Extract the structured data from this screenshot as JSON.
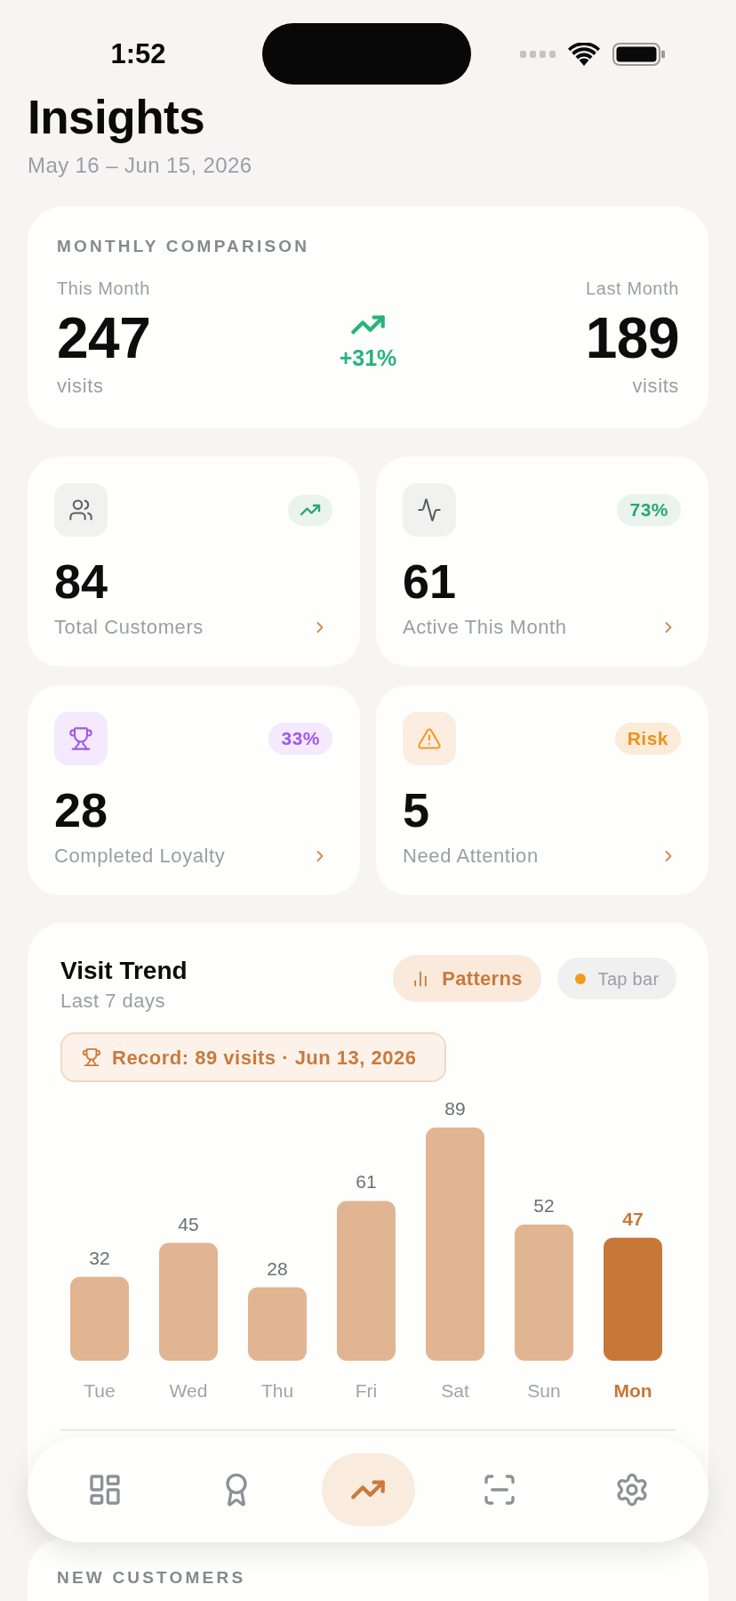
{
  "status_bar": {
    "time": "1:52"
  },
  "header": {
    "title": "Insights",
    "date_range": "May 16 – Jun 15, 2026"
  },
  "monthly_comparison": {
    "heading": "MONTHLY COMPARISON",
    "this_month": {
      "label": "This Month",
      "value": "247",
      "unit": "visits"
    },
    "change": {
      "kind": "up",
      "text": "+31%"
    },
    "last_month": {
      "label": "Last Month",
      "value": "189",
      "unit": "visits"
    }
  },
  "stat_rows": [
    {
      "cards": [
        {
          "kind": "customers",
          "value": "84",
          "label": "Total Customers",
          "badge": {
            "kind": "trend"
          }
        },
        {
          "kind": "active",
          "value": "61",
          "label": "Active This Month",
          "badge": {
            "kind": "text",
            "text": "73%"
          }
        }
      ]
    },
    {
      "cards": [
        {
          "kind": "loyalty",
          "value": "28",
          "label": "Completed Loyalty",
          "badge": {
            "kind": "text",
            "text": "33%"
          }
        },
        {
          "kind": "attention",
          "value": "5",
          "label": "Need Attention",
          "badge": {
            "kind": "text",
            "text": "Risk"
          }
        }
      ]
    }
  ],
  "visit_trend": {
    "title": "Visit Trend",
    "subtitle": "Last 7 days",
    "patterns_button": "Patterns",
    "tap_hint": "Tap bar",
    "record": "Record: 89 visits · Jun 13, 2026",
    "bars": [
      {
        "selected": false
      },
      {
        "selected": false
      },
      {
        "selected": false
      },
      {
        "selected": false
      },
      {
        "selected": false
      },
      {
        "selected": false
      },
      {
        "selected": true
      }
    ],
    "chart_data": {
      "type": "bar",
      "categories": [
        "Tue",
        "Wed",
        "Thu",
        "Fri",
        "Sat",
        "Sun",
        "Mon"
      ],
      "values": [
        32,
        45,
        28,
        61,
        89,
        52,
        47
      ],
      "data_labels": true
    }
  },
  "nav": {
    "items": [
      {
        "kind": "dashboard",
        "selected": false
      },
      {
        "kind": "rewards",
        "selected": false
      },
      {
        "kind": "insights",
        "selected": true
      },
      {
        "kind": "scan",
        "selected": false
      },
      {
        "kind": "settings",
        "selected": false
      }
    ]
  },
  "new_customers": {
    "heading": "NEW CUSTOMERS"
  }
}
